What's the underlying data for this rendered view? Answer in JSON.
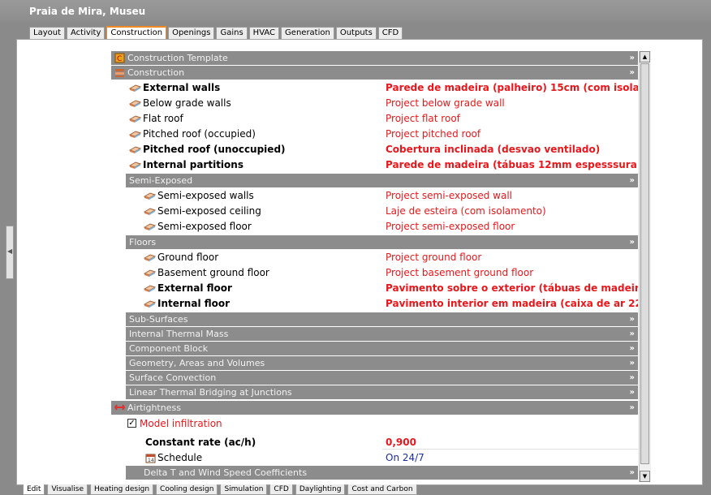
{
  "window": {
    "title": "Praia de Mira, Museu"
  },
  "top_tabs": [
    "Layout",
    "Activity",
    "Construction",
    "Openings",
    "Gains",
    "HVAC",
    "Generation",
    "Outputs",
    "CFD"
  ],
  "active_top_tab": "Construction",
  "sections": {
    "construction_template": "Construction Template",
    "construction": "Construction",
    "semi_exposed": "Semi-Exposed",
    "floors": "Floors",
    "sub_surfaces": "Sub-Surfaces",
    "internal_thermal_mass": "Internal Thermal Mass",
    "component_block": "Component Block",
    "geometry": "Geometry, Areas and Volumes",
    "surface_convection": "Surface Convection",
    "thermal_bridging": "Linear Thermal Bridging at Junctions",
    "airtightness": "Airtightness",
    "delta_t": "Delta T and Wind Speed Coefficients"
  },
  "construction_items": [
    {
      "label": "External walls",
      "value": "Parede de madeira (palheiro) 15cm (com isola"
    },
    {
      "label": "Below grade walls",
      "value": "Project below grade wall"
    },
    {
      "label": "Flat roof",
      "value": "Project flat roof"
    },
    {
      "label": "Pitched roof (occupied)",
      "value": "Project pitched roof"
    },
    {
      "label": "Pitched roof (unoccupied)",
      "value": "Cobertura inclinada (desvao ventilado)"
    },
    {
      "label": "Internal partitions",
      "value": "Parede de madeira (tábuas 12mm espesssura"
    }
  ],
  "semi_exposed_items": [
    {
      "label": "Semi-exposed walls",
      "value": "Project semi-exposed wall"
    },
    {
      "label": "Semi-exposed ceiling",
      "value": "Laje de esteira (com isolamento)"
    },
    {
      "label": "Semi-exposed floor",
      "value": "Project semi-exposed floor"
    }
  ],
  "floor_items": [
    {
      "label": "Ground floor",
      "value": "Project ground floor"
    },
    {
      "label": "Basement ground floor",
      "value": "Project basement ground floor"
    },
    {
      "label": "External floor",
      "value": "Pavimento sobre o exterior (tábuas de madeir"
    },
    {
      "label": "Internal floor",
      "value": "Pavimento interior em madeira (caixa de ar 22"
    }
  ],
  "airtightness": {
    "model_infiltration_label": "Model infiltration",
    "model_infiltration_checked": true,
    "constant_rate_label": "Constant rate (ac/h)",
    "constant_rate_value": "0,900",
    "schedule_label": "Schedule",
    "schedule_value": "On 24/7"
  },
  "bottom_tabs": [
    "Edit",
    "Visualise",
    "Heating design",
    "Cooling design",
    "Simulation",
    "CFD",
    "Daylighting",
    "Cost and Carbon"
  ],
  "active_bottom_tab": "Edit",
  "colors": {
    "value_red": "#e8171c",
    "header_gray": "#8c8c8c",
    "tab_accent": "#f08a24",
    "schedule_blue": "#1c2f9c"
  }
}
